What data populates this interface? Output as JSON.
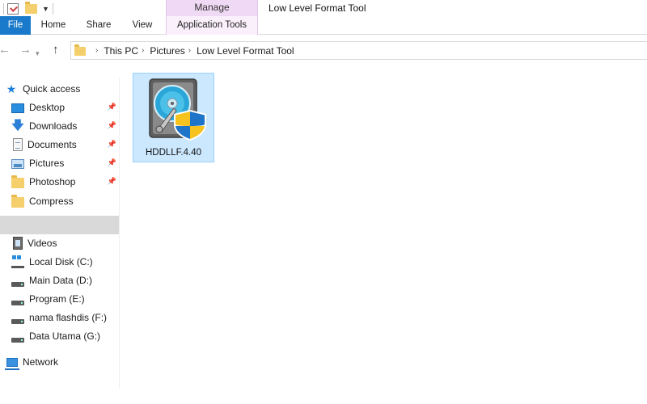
{
  "window": {
    "title": "Low Level Format Tool",
    "context_group": "Manage"
  },
  "ribbon": {
    "tabs": [
      {
        "label": "File"
      },
      {
        "label": "Home"
      },
      {
        "label": "Share"
      },
      {
        "label": "View"
      },
      {
        "label": "Application Tools"
      }
    ]
  },
  "address": {
    "breadcrumbs": [
      "This PC",
      "Pictures",
      "Low Level Format Tool"
    ]
  },
  "nav_pane": {
    "quick_access": {
      "label": "Quick access",
      "icon": "star-icon"
    },
    "pinned": [
      {
        "label": "Desktop",
        "icon": "desktop-icon"
      },
      {
        "label": "Downloads",
        "icon": "download-arrow-icon"
      },
      {
        "label": "Documents",
        "icon": "documents-icon"
      },
      {
        "label": "Pictures",
        "icon": "pictures-icon"
      },
      {
        "label": "Photoshop",
        "icon": "folder-icon"
      }
    ],
    "recent": [
      {
        "label": "Compress",
        "icon": "folder-icon"
      }
    ],
    "this_pc": [
      {
        "label": "Videos",
        "icon": "videos-icon"
      },
      {
        "label": "Local Disk (C:)",
        "icon": "local-disk-icon"
      },
      {
        "label": "Main Data (D:)",
        "icon": "drive-icon"
      },
      {
        "label": "Program (E:)",
        "icon": "drive-icon"
      },
      {
        "label": "nama flashdis (F:)",
        "icon": "drive-icon"
      },
      {
        "label": "Data Utama (G:)",
        "icon": "drive-icon"
      }
    ],
    "network": {
      "label": "Network",
      "icon": "network-icon"
    }
  },
  "content": {
    "items": [
      {
        "name": "HDDLLF.4.40",
        "icon": "hard-drive-shield-icon",
        "selected": true
      }
    ]
  },
  "colors": {
    "file_tab": "#1979ca",
    "context_tab": "#f0d9f5",
    "selection_fill": "#cce8ff",
    "selection_border": "#99d1ff"
  }
}
